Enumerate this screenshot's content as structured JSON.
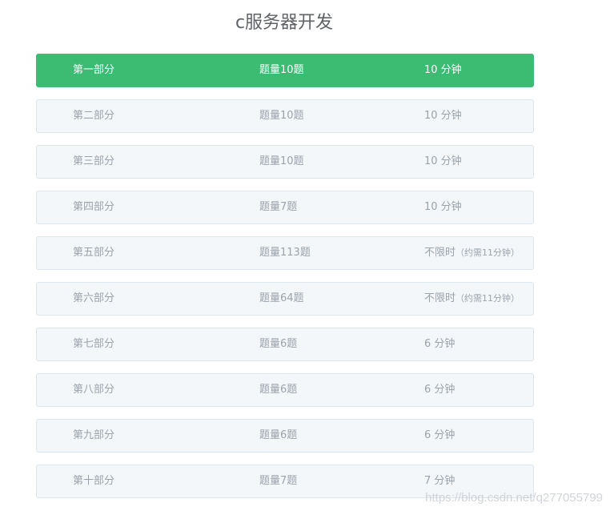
{
  "page": {
    "title": "c服务器开发"
  },
  "parts": [
    {
      "name": "第一部分",
      "count": "题量10题",
      "time": "10 分钟",
      "time_note": "",
      "active": true
    },
    {
      "name": "第二部分",
      "count": "题量10题",
      "time": "10 分钟",
      "time_note": "",
      "active": false
    },
    {
      "name": "第三部分",
      "count": "题量10题",
      "time": "10 分钟",
      "time_note": "",
      "active": false
    },
    {
      "name": "第四部分",
      "count": "题量7题",
      "time": "10 分钟",
      "time_note": "",
      "active": false
    },
    {
      "name": "第五部分",
      "count": "题量113题",
      "time": "不限时",
      "time_note": "（约需11分钟）",
      "active": false
    },
    {
      "name": "第六部分",
      "count": "题量64题",
      "time": "不限时",
      "time_note": "（约需11分钟）",
      "active": false
    },
    {
      "name": "第七部分",
      "count": "题量6题",
      "time": "6 分钟",
      "time_note": "",
      "active": false
    },
    {
      "name": "第八部分",
      "count": "题量6题",
      "time": "6 分钟",
      "time_note": "",
      "active": false
    },
    {
      "name": "第九部分",
      "count": "题量6题",
      "time": "6 分钟",
      "time_note": "",
      "active": false
    },
    {
      "name": "第十部分",
      "count": "题量7题",
      "time": "7 分钟",
      "time_note": "",
      "active": false
    }
  ],
  "watermark": "https://blog.csdn.net/q277055799",
  "colors": {
    "active_bg": "#3bbc72",
    "row_bg": "#f4f7fa",
    "row_border": "#dde5ec",
    "row_text": "#9aa2ab",
    "title_text": "#5f6368"
  }
}
